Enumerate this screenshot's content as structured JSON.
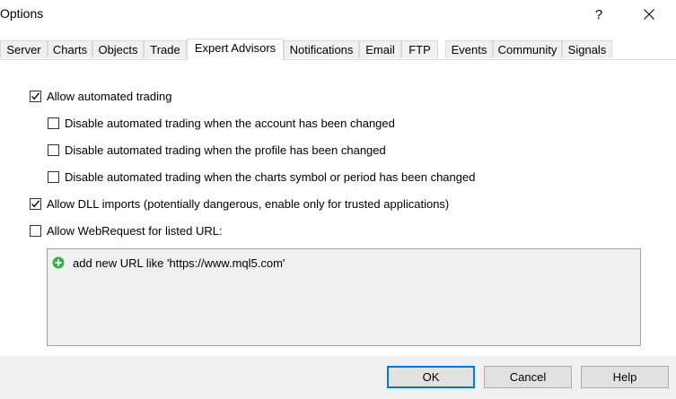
{
  "window": {
    "title": "Options",
    "help_glyph": "?"
  },
  "tabs": [
    {
      "label": "Server"
    },
    {
      "label": "Charts"
    },
    {
      "label": "Objects"
    },
    {
      "label": "Trade"
    },
    {
      "label": "Expert Advisors",
      "active": true
    },
    {
      "label": "Notifications"
    },
    {
      "label": "Email"
    },
    {
      "label": "FTP"
    },
    {
      "label": "Events"
    },
    {
      "label": "Community"
    },
    {
      "label": "Signals"
    }
  ],
  "options": {
    "allow_automated_trading": {
      "label": "Allow automated trading",
      "checked": true
    },
    "disable_account_changed": {
      "label": "Disable automated trading when the account has been changed",
      "checked": false
    },
    "disable_profile_changed": {
      "label": "Disable automated trading when the profile has been changed",
      "checked": false
    },
    "disable_symbol_changed": {
      "label": "Disable automated trading when the charts symbol or period has been changed",
      "checked": false
    },
    "allow_dll_imports": {
      "label": "Allow DLL imports (potentially dangerous, enable only for trusted applications)",
      "checked": true
    },
    "allow_webrequest": {
      "label": "Allow WebRequest for listed URL:",
      "checked": false
    }
  },
  "url_list": {
    "add_item_label": "add new URL like 'https://www.mql5.com'",
    "icon": "plus-circle-icon",
    "icon_color": "#3cb043"
  },
  "buttons": {
    "ok": "OK",
    "cancel": "Cancel",
    "help": "Help"
  },
  "colors": {
    "accent": "#0078d7",
    "panel_bg": "#f0f0f0"
  }
}
